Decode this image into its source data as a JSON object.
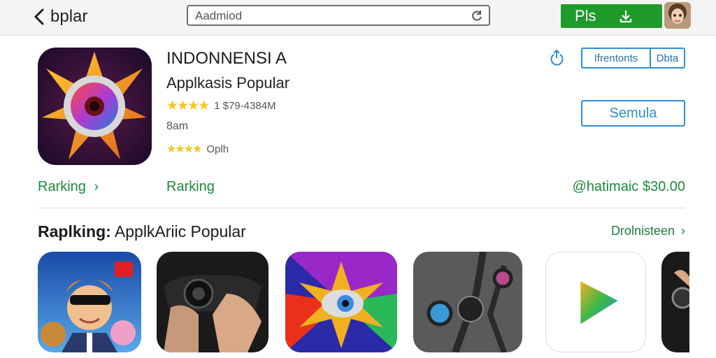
{
  "topbar": {
    "back_label": "bplar",
    "search_text": "Aadmiod",
    "get_label": "Pls",
    "icons": {
      "back": "chevron-left-icon",
      "search": "refresh-icon",
      "download": "download-icon"
    }
  },
  "app": {
    "title": "INDONNENSI A",
    "subtitle": "Applkasis Popular",
    "stars": "★★★★",
    "rating_text": "1 $79-4384M",
    "age": "8am",
    "stars2": "★★★★",
    "rating2_text": "Oplh",
    "segment_left": "Ifrentonts",
    "segment_right": "Dbta",
    "open_label": "Semula",
    "rank_link": "Rarking",
    "rank_label": "Rarking",
    "price": "@hatimaic $30.00"
  },
  "section": {
    "title_bold": "Raplking:",
    "title_rest": " ApplkAriic Popular",
    "see_all": "Drolnisteen"
  },
  "colors": {
    "accent_green": "#1e9b2b",
    "link_green": "#1e8a3a",
    "accent_blue": "#2a8fd6",
    "star": "#f3c623"
  }
}
